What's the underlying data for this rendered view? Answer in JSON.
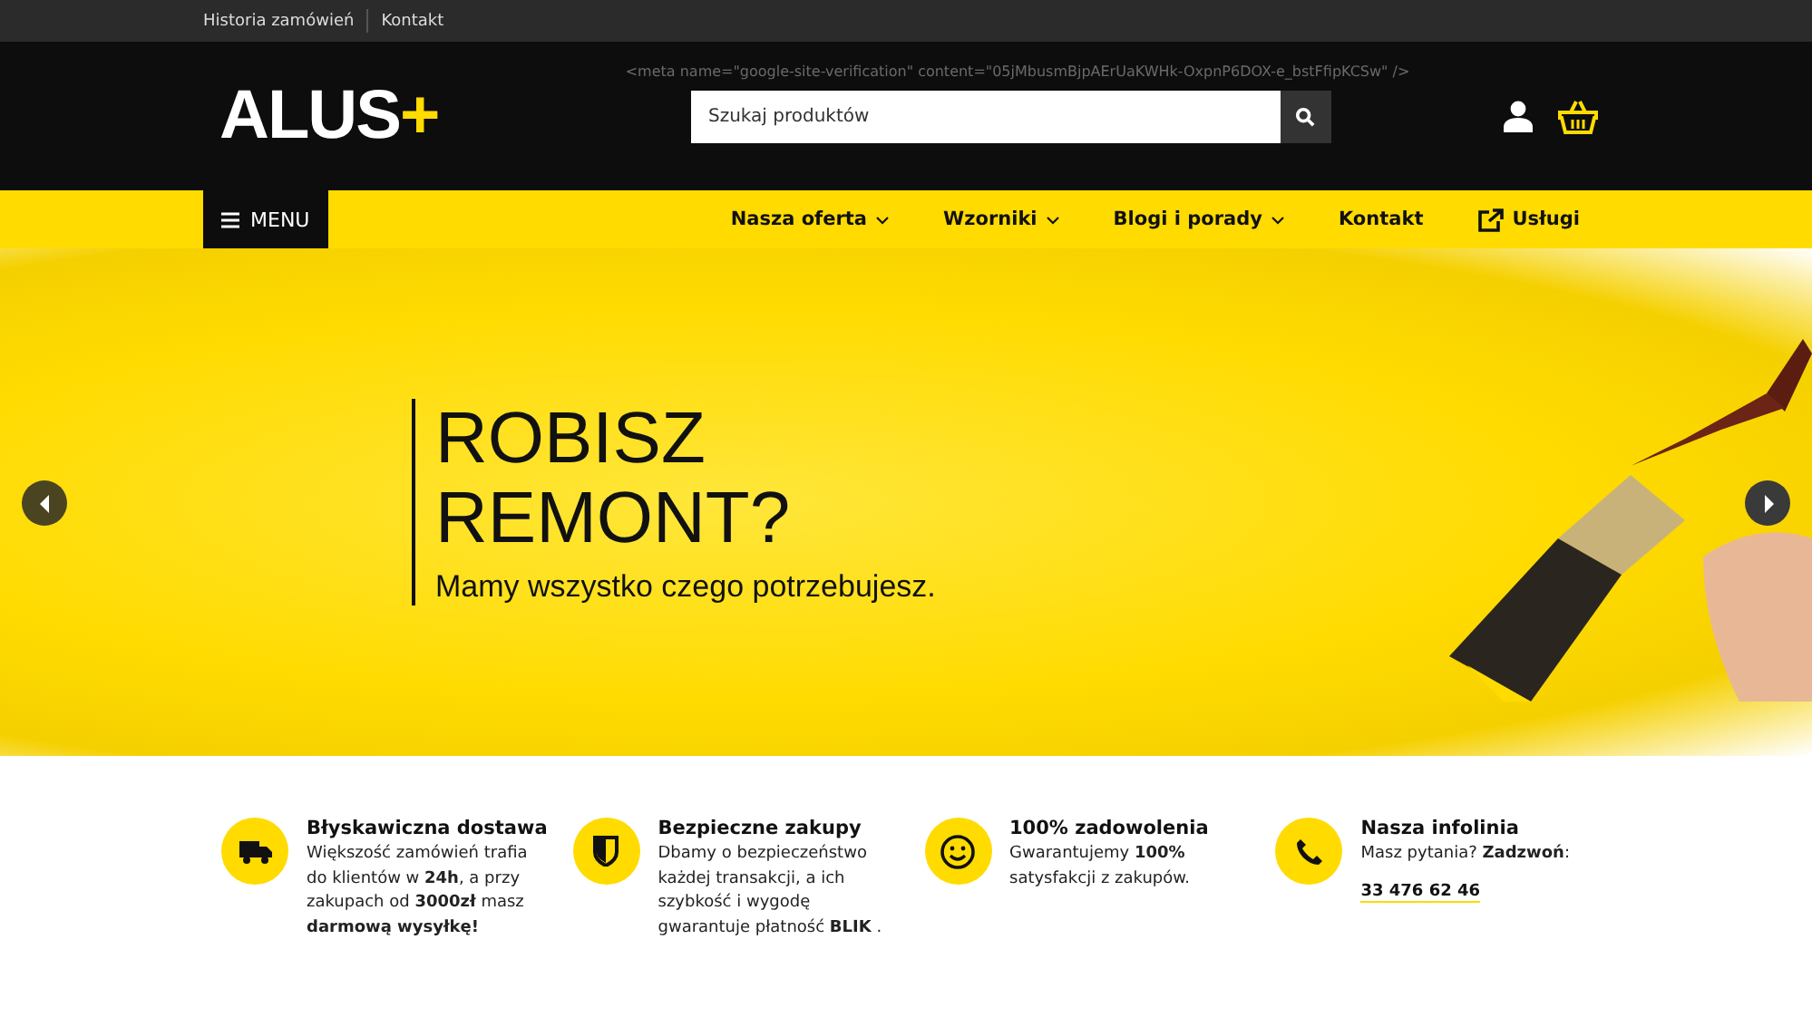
{
  "top_bar": {
    "links": [
      "Historia zamówień",
      "Kontakt"
    ]
  },
  "header": {
    "logo": {
      "text": "ALUS",
      "symbol": "+"
    },
    "meta_text": "<meta name=\"google-site-verification\" content=\"05jMbusmBjpAErUaKWHk-OxpnP6DOX-e_bstFfipKCSw\" />",
    "search": {
      "placeholder": "Szukaj produktów"
    }
  },
  "nav": {
    "menu_button": "MENU",
    "items": [
      {
        "label": "Nasza oferta",
        "kind": "dropdown"
      },
      {
        "label": "Wzorniki",
        "kind": "dropdown"
      },
      {
        "label": "Blogi i porady",
        "kind": "dropdown"
      },
      {
        "label": "Kontakt",
        "kind": "link"
      },
      {
        "label": "Usługi",
        "kind": "external"
      }
    ]
  },
  "hero": {
    "title_lines": [
      "ROBISZ",
      "REMONT?"
    ],
    "subtitle": "Mamy wszystko czego potrzebujesz."
  },
  "features": [
    {
      "kind": "truck",
      "title": "Błyskawiczna dostawa",
      "text": "Większość zamówień trafia do klientów w **24h**, a przy zakupach od **3000zł** masz **darmową wysyłkę!**"
    },
    {
      "kind": "shield",
      "title": "Bezpieczne zakupy",
      "text": "Dbamy o bezpieczeństwo każdej transakcji, a ich szybkość i wygodę gwarantuje płatność **BLIK** ."
    },
    {
      "kind": "smile",
      "title": "100% zadowolenia",
      "text": "Gwarantujemy **100%** satysfakcji z zakupów."
    },
    {
      "kind": "phone",
      "title": "Nasza infolinia",
      "text": "Masz pytania? **Zadzwoń**:",
      "phone": "33 476 62 46"
    }
  ]
}
